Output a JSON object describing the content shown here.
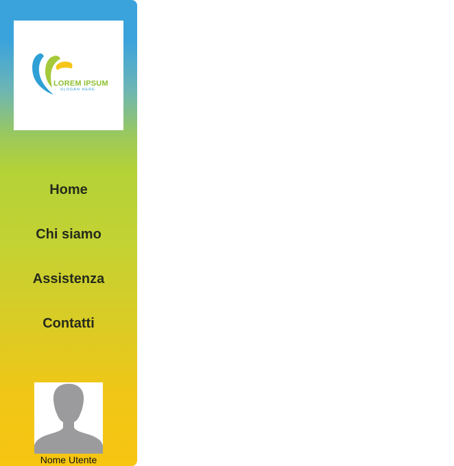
{
  "logo": {
    "title": "LOREM IPSUM",
    "slogan": "SLOGAN HERE",
    "colors": {
      "blue": "#2fa0d5",
      "green": "#8dbf2e",
      "yellow": "#f5c518"
    }
  },
  "nav": {
    "items": [
      {
        "label": "Home"
      },
      {
        "label": "Chi siamo"
      },
      {
        "label": "Assistenza"
      },
      {
        "label": "Contatti"
      }
    ]
  },
  "user": {
    "name": "Nome Utente",
    "avatar_icon": "user-silhouette-icon"
  },
  "theme": {
    "gradient_top": "#3ba3dc",
    "gradient_mid": "#b4d236",
    "gradient_bottom": "#f7c512",
    "nav_text": "#262b1c"
  }
}
